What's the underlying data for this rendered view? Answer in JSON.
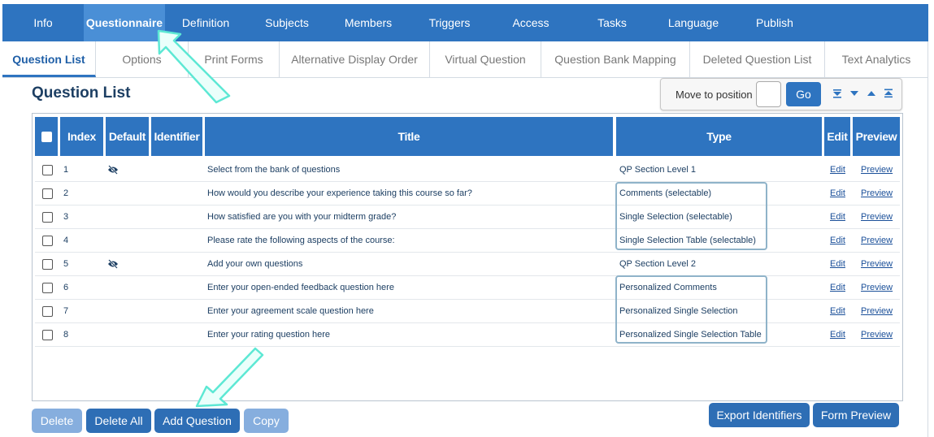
{
  "topnav": [
    "Info",
    "Questionnaire",
    "Definition",
    "Subjects",
    "Members",
    "Triggers",
    "Access",
    "Tasks",
    "Language",
    "Publish"
  ],
  "topnav_active": "Questionnaire",
  "subtabs": [
    "Question List",
    "Options",
    "Print Forms",
    "Alternative Display Order",
    "Virtual Question",
    "Question Bank Mapping",
    "Deleted Question List",
    "Text Analytics"
  ],
  "subtabs_active": "Question List",
  "page_title": "Question List",
  "move": {
    "label": "Move to position",
    "go": "Go",
    "input_value": ""
  },
  "table": {
    "headers": {
      "index": "Index",
      "default": "Default",
      "identifier": "Identifier",
      "title": "Title",
      "type": "Type",
      "edit": "Edit",
      "preview": "Preview"
    },
    "rows": [
      {
        "index": "1",
        "default_icon": "eye-slash-icon",
        "identifier": "",
        "title": "Select from the bank of questions",
        "type": "QP Section Level 1",
        "edit": "Edit",
        "preview": "Preview"
      },
      {
        "index": "2",
        "default_icon": "",
        "identifier": "",
        "title": "How would you describe your experience taking this course so far?",
        "type": "Comments (selectable)",
        "edit": "Edit",
        "preview": "Preview"
      },
      {
        "index": "3",
        "default_icon": "",
        "identifier": "",
        "title": "How satisfied are you with your midterm grade?",
        "type": "Single Selection (selectable)",
        "edit": "Edit",
        "preview": "Preview"
      },
      {
        "index": "4",
        "default_icon": "",
        "identifier": "",
        "title": "Please rate the following aspects of the course:",
        "type": "Single Selection Table (selectable)",
        "edit": "Edit",
        "preview": "Preview"
      },
      {
        "index": "5",
        "default_icon": "eye-slash-icon",
        "identifier": "",
        "title": "Add your own questions",
        "type": "QP Section Level 2",
        "edit": "Edit",
        "preview": "Preview"
      },
      {
        "index": "6",
        "default_icon": "",
        "identifier": "",
        "title": "Enter your open-ended feedback question here",
        "type": "Personalized Comments",
        "edit": "Edit",
        "preview": "Preview"
      },
      {
        "index": "7",
        "default_icon": "",
        "identifier": "",
        "title": "Enter your agreement scale question here",
        "type": "Personalized Single Selection",
        "edit": "Edit",
        "preview": "Preview"
      },
      {
        "index": "8",
        "default_icon": "",
        "identifier": "",
        "title": "Enter your rating question here",
        "type": "Personalized Single Selection Table",
        "edit": "Edit",
        "preview": "Preview"
      }
    ]
  },
  "buttons": {
    "delete": "Delete",
    "delete_all": "Delete All",
    "add_question": "Add Question",
    "copy": "Copy",
    "export_identifiers": "Export Identifiers",
    "form_preview": "Form Preview"
  },
  "colors": {
    "primary": "#2e74c0",
    "active_tab": "#4a8fd6",
    "disabled_button": "#86aede",
    "highlight_box": "#8fb3c9",
    "arrow": "#5de8d4"
  }
}
